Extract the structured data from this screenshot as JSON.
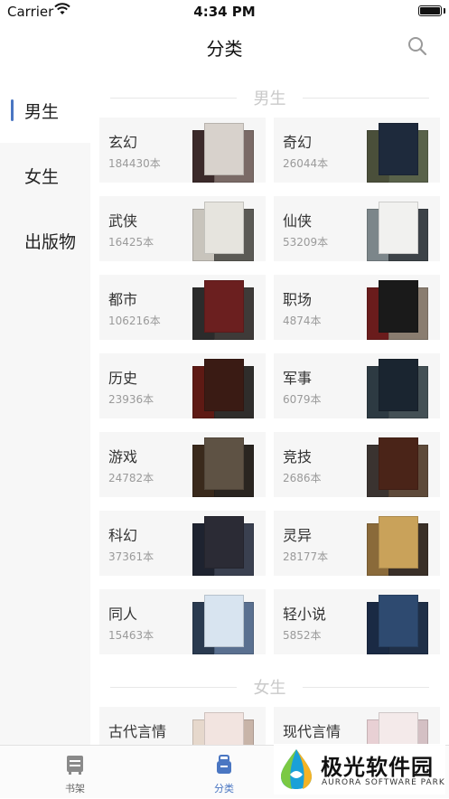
{
  "status": {
    "carrier": "Carrier",
    "time": "4:34 PM"
  },
  "nav": {
    "title": "分类"
  },
  "sidebar": {
    "items": [
      {
        "label": "男生",
        "active": true
      },
      {
        "label": "女生",
        "active": false
      },
      {
        "label": "出版物",
        "active": false
      }
    ]
  },
  "sections": [
    {
      "title": "男生",
      "categories": [
        {
          "name": "玄幻",
          "count": "184430本",
          "covers": [
            "#3b2a2a",
            "#d8d2cc",
            "#7a6a66"
          ]
        },
        {
          "name": "奇幻",
          "count": "26044本",
          "covers": [
            "#4a4f3a",
            "#1e2a3c",
            "#59624a"
          ]
        },
        {
          "name": "武侠",
          "count": "16425本",
          "covers": [
            "#c8c4bc",
            "#e6e4de",
            "#5b5a55"
          ]
        },
        {
          "name": "仙侠",
          "count": "53209本",
          "covers": [
            "#7c868a",
            "#f1f1ef",
            "#3d4348"
          ]
        },
        {
          "name": "都市",
          "count": "106216本",
          "covers": [
            "#2b2b2b",
            "#6b1f1f",
            "#3e3a38"
          ]
        },
        {
          "name": "职场",
          "count": "4874本",
          "covers": [
            "#6a1c1c",
            "#1a1a1a",
            "#8a7d70"
          ]
        },
        {
          "name": "历史",
          "count": "23936本",
          "covers": [
            "#5e1a14",
            "#3a1b14",
            "#2f2d2b"
          ]
        },
        {
          "name": "军事",
          "count": "6079本",
          "covers": [
            "#2d3a42",
            "#1a2530",
            "#445055"
          ]
        },
        {
          "name": "游戏",
          "count": "24782本",
          "covers": [
            "#3a2a1c",
            "#5e5244",
            "#2a2520"
          ]
        },
        {
          "name": "竞技",
          "count": "2686本",
          "covers": [
            "#3a3330",
            "#4a2418",
            "#5e4a3a"
          ]
        },
        {
          "name": "科幻",
          "count": "37361本",
          "covers": [
            "#1e2330",
            "#2b2b35",
            "#3a4050"
          ]
        },
        {
          "name": "灵异",
          "count": "28177本",
          "covers": [
            "#8a6a3a",
            "#c9a25a",
            "#3a3028"
          ]
        },
        {
          "name": "同人",
          "count": "15463本",
          "covers": [
            "#2a3a50",
            "#d8e4f0",
            "#5a7090"
          ]
        },
        {
          "name": "轻小说",
          "count": "5852本",
          "covers": [
            "#1a2a44",
            "#2e4a70",
            "#203048"
          ]
        }
      ]
    },
    {
      "title": "女生",
      "categories": [
        {
          "name": "古代言情",
          "count": "",
          "covers": [
            "#e6d8cc",
            "#f2e4e0",
            "#c8b4a8"
          ]
        },
        {
          "name": "现代言情",
          "count": "",
          "covers": [
            "#e8d0d4",
            "#f4eaea",
            "#d4c0c4"
          ]
        }
      ]
    }
  ],
  "tabbar": {
    "items": [
      {
        "label": "书架",
        "active": false
      },
      {
        "label": "分类",
        "active": true
      }
    ]
  },
  "watermark": {
    "name": "极光软件园",
    "sub": "AURORA SOFTWARE PARK"
  },
  "colors": {
    "accent": "#4a76c2",
    "card_bg": "#f6f6f6",
    "sidebar_bg": "#f7f7f7"
  }
}
